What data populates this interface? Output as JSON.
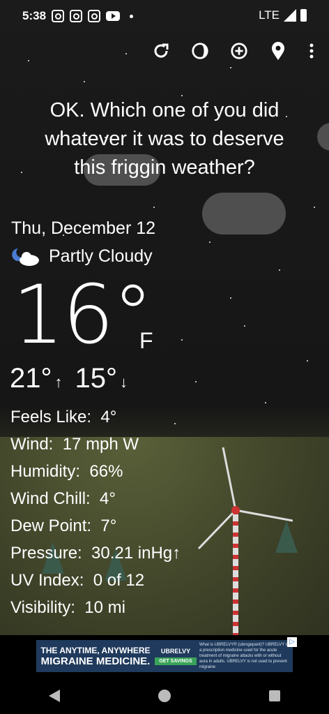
{
  "status": {
    "time": "5:38",
    "network": "LTE"
  },
  "toolbar": {
    "refresh": "refresh-icon",
    "theme": "theme-icon",
    "add": "add-location-icon",
    "location": "location-pin-icon",
    "more": "overflow-menu-icon"
  },
  "quote": {
    "line1": "OK. Which one of you did",
    "line2": "whatever it was to deserve",
    "line3": "this friggin weather?"
  },
  "weather": {
    "date": "Thu, December 12",
    "condition": "Partly Cloudy",
    "temp": "16°",
    "unit": "F",
    "high": "21°",
    "low": "15°",
    "details": [
      {
        "label": "Feels Like:",
        "value": "4°"
      },
      {
        "label": "Wind:",
        "value": "17 mph W"
      },
      {
        "label": "Humidity:",
        "value": "66%"
      },
      {
        "label": "Wind Chill:",
        "value": "4°"
      },
      {
        "label": "Dew Point:",
        "value": "7°"
      },
      {
        "label": "Pressure:",
        "value": "30.21 inHg↑"
      },
      {
        "label": "UV Index:",
        "value": "0 of 12"
      },
      {
        "label": "Visibility:",
        "value": "10 mi"
      }
    ]
  },
  "ad": {
    "headline1": "THE ANYTIME, ANYWHERE",
    "headline2": "MIGRAINE MEDICINE.",
    "brand": "UBRELVY",
    "cta": "GET SAVINGS",
    "copy": "What is UBRELVY® (ubrogepant)? UBRELVY is a prescription medicine used for the acute treatment of migraine attacks with or without aura in adults. UBRELVY is not used to prevent migraine"
  }
}
